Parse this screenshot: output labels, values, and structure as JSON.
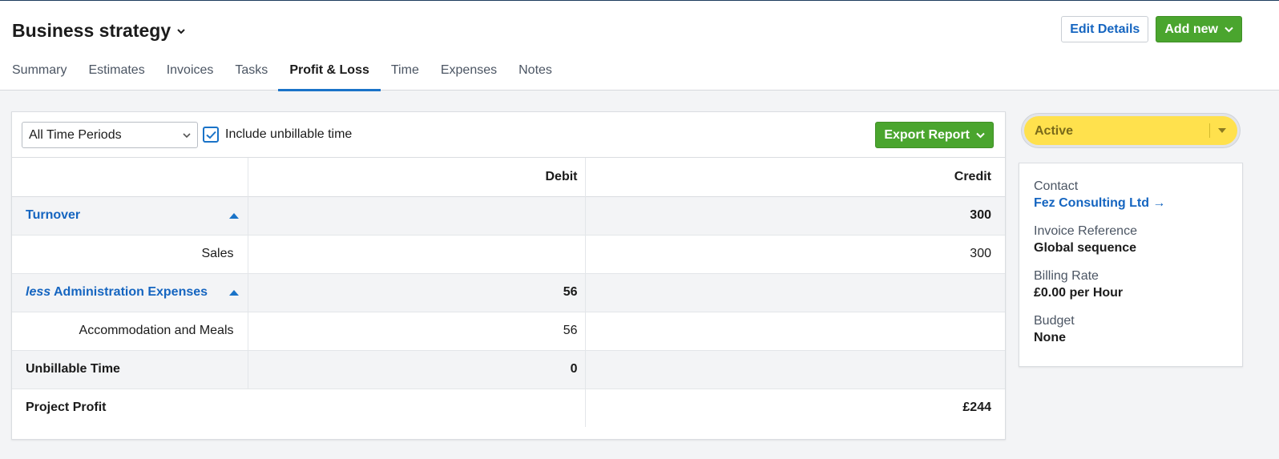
{
  "header": {
    "title": "Business strategy",
    "edit_label": "Edit Details",
    "add_new_label": "Add new"
  },
  "tabs": [
    {
      "label": "Summary"
    },
    {
      "label": "Estimates"
    },
    {
      "label": "Invoices"
    },
    {
      "label": "Tasks"
    },
    {
      "label": "Profit & Loss",
      "active": true
    },
    {
      "label": "Time"
    },
    {
      "label": "Expenses"
    },
    {
      "label": "Notes"
    }
  ],
  "toolbar": {
    "period_selected": "All Time Periods",
    "include_unbillable_label": "Include unbillable time",
    "include_unbillable_checked": true,
    "export_label": "Export Report"
  },
  "table": {
    "headers": {
      "debit": "Debit",
      "credit": "Credit"
    },
    "turnover": {
      "label": "Turnover",
      "credit": "300"
    },
    "sales": {
      "label": "Sales",
      "credit": "300"
    },
    "admin": {
      "prefix": "less",
      "label": "Administration Expenses",
      "debit": "56"
    },
    "accommodation": {
      "label": "Accommodation and Meals",
      "debit": "56"
    },
    "unbillable": {
      "label": "Unbillable Time",
      "debit": "0"
    },
    "profit": {
      "label": "Project Profit",
      "credit": "£244"
    }
  },
  "status": {
    "label": "Active",
    "color": "#ffe14d"
  },
  "details": {
    "contact_label": "Contact",
    "contact_value": "Fez Consulting Ltd →",
    "invoice_ref_label": "Invoice Reference",
    "invoice_ref_value": "Global sequence",
    "billing_rate_label": "Billing Rate",
    "billing_rate_value": "£0.00 per Hour",
    "budget_label": "Budget",
    "budget_value": "None"
  },
  "colors": {
    "accent": "#1a73c8",
    "link": "#1565c0",
    "green": "#4aa52e"
  }
}
